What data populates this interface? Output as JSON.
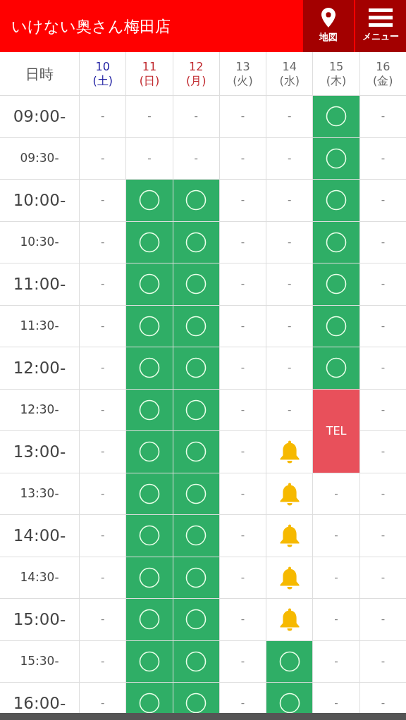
{
  "header": {
    "title": "いけない奥さん梅田店",
    "buttons": [
      {
        "kind": "map",
        "label": "地図"
      },
      {
        "kind": "menu",
        "label": "メニュー"
      }
    ]
  },
  "table": {
    "corner": "日時",
    "days": [
      {
        "date": "10",
        "weekday": "(土)",
        "kind": "saturday"
      },
      {
        "date": "11",
        "weekday": "(日)",
        "kind": "holiday"
      },
      {
        "date": "12",
        "weekday": "(月)",
        "kind": "holiday"
      },
      {
        "date": "13",
        "weekday": "(火)",
        "kind": "weekday"
      },
      {
        "date": "14",
        "weekday": "(水)",
        "kind": "weekday"
      },
      {
        "date": "15",
        "weekday": "(木)",
        "kind": "weekday"
      },
      {
        "date": "16",
        "weekday": "(金)",
        "kind": "weekday"
      }
    ],
    "rows": [
      {
        "time": "09:00-",
        "kind": "hour",
        "cells": [
          {
            "kind": "none",
            "text": "-"
          },
          {
            "kind": "none",
            "text": "-"
          },
          {
            "kind": "none",
            "text": "-"
          },
          {
            "kind": "none",
            "text": "-"
          },
          {
            "kind": "none",
            "text": "-"
          },
          {
            "kind": "open"
          },
          {
            "kind": "none",
            "text": "-"
          }
        ]
      },
      {
        "time": "09:30-",
        "kind": "half",
        "cells": [
          {
            "kind": "none",
            "text": "-"
          },
          {
            "kind": "none",
            "text": "-"
          },
          {
            "kind": "none",
            "text": "-"
          },
          {
            "kind": "none",
            "text": "-"
          },
          {
            "kind": "none",
            "text": "-"
          },
          {
            "kind": "open"
          },
          {
            "kind": "none",
            "text": "-"
          }
        ]
      },
      {
        "time": "10:00-",
        "kind": "hour",
        "cells": [
          {
            "kind": "none",
            "text": "-"
          },
          {
            "kind": "open"
          },
          {
            "kind": "open"
          },
          {
            "kind": "none",
            "text": "-"
          },
          {
            "kind": "none",
            "text": "-"
          },
          {
            "kind": "open"
          },
          {
            "kind": "none",
            "text": "-"
          }
        ]
      },
      {
        "time": "10:30-",
        "kind": "half",
        "cells": [
          {
            "kind": "none",
            "text": "-"
          },
          {
            "kind": "open"
          },
          {
            "kind": "open"
          },
          {
            "kind": "none",
            "text": "-"
          },
          {
            "kind": "none",
            "text": "-"
          },
          {
            "kind": "open"
          },
          {
            "kind": "none",
            "text": "-"
          }
        ]
      },
      {
        "time": "11:00-",
        "kind": "hour",
        "cells": [
          {
            "kind": "none",
            "text": "-"
          },
          {
            "kind": "open"
          },
          {
            "kind": "open"
          },
          {
            "kind": "none",
            "text": "-"
          },
          {
            "kind": "none",
            "text": "-"
          },
          {
            "kind": "open"
          },
          {
            "kind": "none",
            "text": "-"
          }
        ]
      },
      {
        "time": "11:30-",
        "kind": "half",
        "cells": [
          {
            "kind": "none",
            "text": "-"
          },
          {
            "kind": "open"
          },
          {
            "kind": "open"
          },
          {
            "kind": "none",
            "text": "-"
          },
          {
            "kind": "none",
            "text": "-"
          },
          {
            "kind": "open"
          },
          {
            "kind": "none",
            "text": "-"
          }
        ]
      },
      {
        "time": "12:00-",
        "kind": "hour",
        "cells": [
          {
            "kind": "none",
            "text": "-"
          },
          {
            "kind": "open"
          },
          {
            "kind": "open"
          },
          {
            "kind": "none",
            "text": "-"
          },
          {
            "kind": "none",
            "text": "-"
          },
          {
            "kind": "open"
          },
          {
            "kind": "none",
            "text": "-"
          }
        ]
      },
      {
        "time": "12:30-",
        "kind": "half",
        "cells": [
          {
            "kind": "none",
            "text": "-"
          },
          {
            "kind": "open"
          },
          {
            "kind": "open"
          },
          {
            "kind": "none",
            "text": "-"
          },
          {
            "kind": "none",
            "text": "-"
          },
          {
            "kind": "tel",
            "text": "TEL",
            "rowspan": 2
          },
          {
            "kind": "none",
            "text": "-"
          }
        ]
      },
      {
        "time": "13:00-",
        "kind": "hour",
        "cells": [
          {
            "kind": "none",
            "text": "-"
          },
          {
            "kind": "open"
          },
          {
            "kind": "open"
          },
          {
            "kind": "none",
            "text": "-"
          },
          {
            "kind": "bell"
          },
          {
            "kind": "none",
            "text": "-"
          }
        ]
      },
      {
        "time": "13:30-",
        "kind": "half",
        "cells": [
          {
            "kind": "none",
            "text": "-"
          },
          {
            "kind": "open"
          },
          {
            "kind": "open"
          },
          {
            "kind": "none",
            "text": "-"
          },
          {
            "kind": "bell"
          },
          {
            "kind": "none",
            "text": "-"
          },
          {
            "kind": "none",
            "text": "-"
          }
        ]
      },
      {
        "time": "14:00-",
        "kind": "hour",
        "cells": [
          {
            "kind": "none",
            "text": "-"
          },
          {
            "kind": "open"
          },
          {
            "kind": "open"
          },
          {
            "kind": "none",
            "text": "-"
          },
          {
            "kind": "bell"
          },
          {
            "kind": "none",
            "text": "-"
          },
          {
            "kind": "none",
            "text": "-"
          }
        ]
      },
      {
        "time": "14:30-",
        "kind": "half",
        "cells": [
          {
            "kind": "none",
            "text": "-"
          },
          {
            "kind": "open"
          },
          {
            "kind": "open"
          },
          {
            "kind": "none",
            "text": "-"
          },
          {
            "kind": "bell"
          },
          {
            "kind": "none",
            "text": "-"
          },
          {
            "kind": "none",
            "text": "-"
          }
        ]
      },
      {
        "time": "15:00-",
        "kind": "hour",
        "cells": [
          {
            "kind": "none",
            "text": "-"
          },
          {
            "kind": "open"
          },
          {
            "kind": "open"
          },
          {
            "kind": "none",
            "text": "-"
          },
          {
            "kind": "bell"
          },
          {
            "kind": "none",
            "text": "-"
          },
          {
            "kind": "none",
            "text": "-"
          }
        ]
      },
      {
        "time": "15:30-",
        "kind": "half",
        "cells": [
          {
            "kind": "none",
            "text": "-"
          },
          {
            "kind": "open"
          },
          {
            "kind": "open"
          },
          {
            "kind": "none",
            "text": "-"
          },
          {
            "kind": "open"
          },
          {
            "kind": "none",
            "text": "-"
          },
          {
            "kind": "none",
            "text": "-"
          }
        ]
      },
      {
        "time": "16:00-",
        "kind": "hour",
        "cells": [
          {
            "kind": "none",
            "text": "-"
          },
          {
            "kind": "open"
          },
          {
            "kind": "open"
          },
          {
            "kind": "none",
            "text": "-"
          },
          {
            "kind": "open"
          },
          {
            "kind": "none",
            "text": "-"
          },
          {
            "kind": "none",
            "text": "-"
          }
        ]
      }
    ]
  }
}
